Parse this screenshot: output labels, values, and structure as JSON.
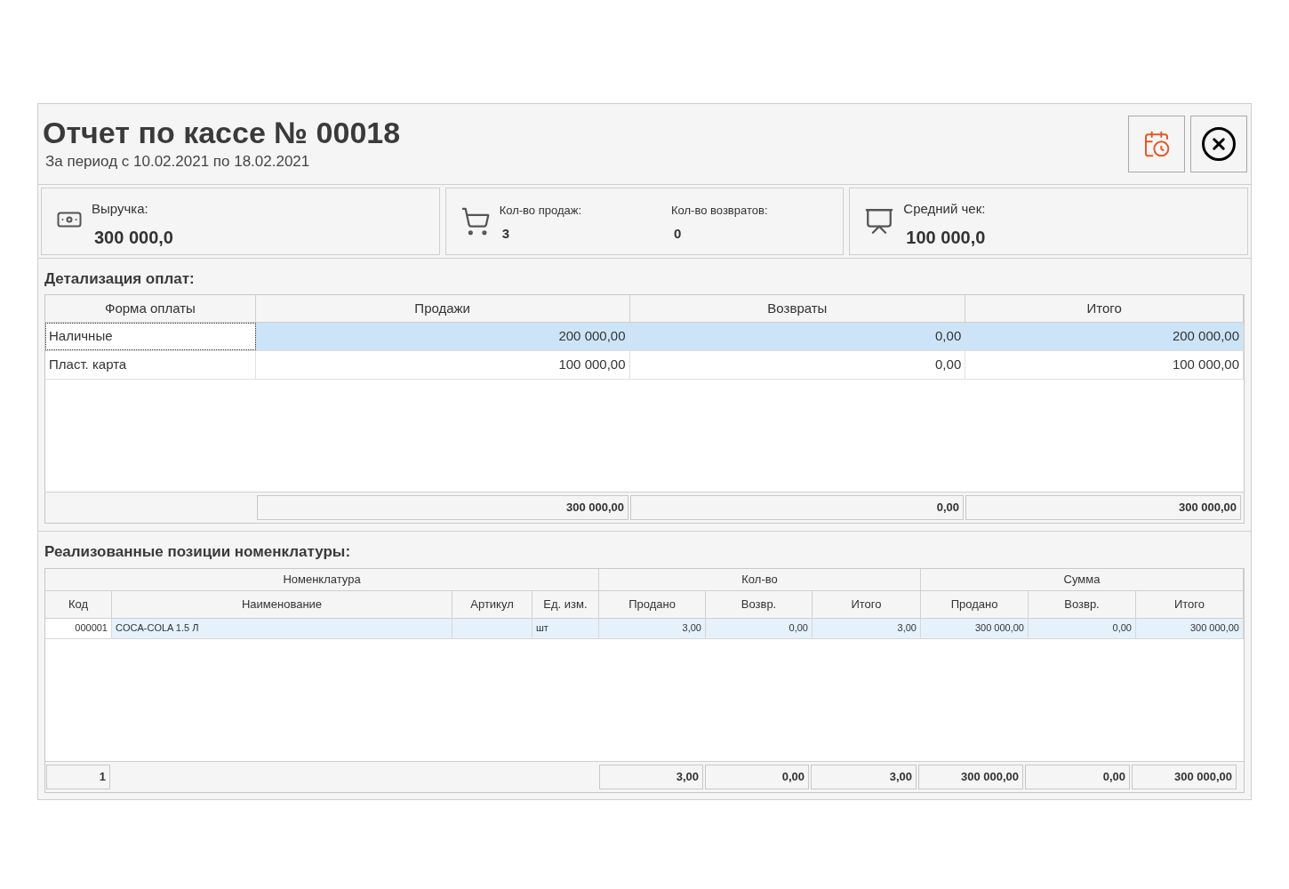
{
  "header": {
    "title": "Отчет по кассе № 00018",
    "subtitle": "За период с 10.02.2021 по 18.02.2021"
  },
  "toolbar": [
    {
      "kind": "calendar"
    },
    {
      "kind": "close"
    }
  ],
  "stats": [
    {
      "kind": "money",
      "metrics": [
        {
          "label": "Выручка:",
          "value": "300 000,0"
        }
      ]
    },
    {
      "kind": "cart",
      "metrics": [
        {
          "label": "Кол-во продаж:",
          "value": "3"
        },
        {
          "label": "Кол-во возвратов:",
          "value": "0"
        }
      ]
    },
    {
      "kind": "chart",
      "metrics": [
        {
          "label": "Средний чек:",
          "value": "100 000,0"
        }
      ]
    }
  ],
  "payments": {
    "title": "Детализация оплат:",
    "columns": [
      "Форма оплаты",
      "Продажи",
      "Возвраты",
      "Итого"
    ],
    "rows": [
      {
        "cells": [
          "Наличные",
          "200 000,00",
          "0,00",
          "200 000,00"
        ],
        "selected": true
      },
      {
        "cells": [
          "Пласт. карта",
          "100 000,00",
          "0,00",
          "100 000,00"
        ],
        "selected": false
      }
    ],
    "totals": [
      "300 000,00",
      "0,00",
      "300 000,00"
    ]
  },
  "items": {
    "title": "Реализованные позиции номенклатуры:",
    "groups": [
      "Номенклатура",
      "Кол-во",
      "Сумма"
    ],
    "columns": [
      "Код",
      "Наименование",
      "Артикул",
      "Ед. изм.",
      "Продано",
      "Возвр.",
      "Итого",
      "Продано",
      "Возвр.",
      "Итого"
    ],
    "rows": [
      {
        "cells": [
          "000001",
          "COCA-COLA 1.5 Л",
          "",
          "шт",
          "3,00",
          "0,00",
          "3,00",
          "300 000,00",
          "0,00",
          "300 000,00"
        ],
        "selected": true
      }
    ],
    "totals": [
      "1",
      "3,00",
      "0,00",
      "3,00",
      "300 000,00",
      "0,00",
      "300 000,00"
    ]
  }
}
